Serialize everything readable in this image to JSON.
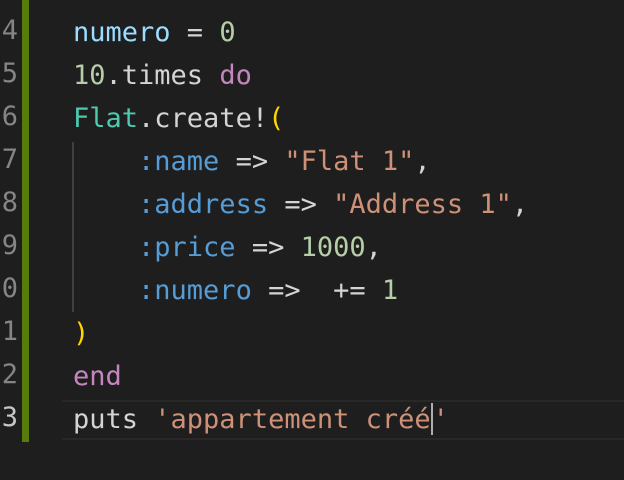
{
  "editor": {
    "line_numbers": [
      "4",
      "5",
      "6",
      "7",
      "8",
      "9",
      "0",
      "1",
      "2",
      "3"
    ],
    "lines": [
      [
        {
          "t": "numero",
          "c": "var"
        },
        {
          "t": " = ",
          "c": "op"
        },
        {
          "t": "0",
          "c": "num"
        }
      ],
      [
        {
          "t": "10",
          "c": "num"
        },
        {
          "t": ".times ",
          "c": "plain"
        },
        {
          "t": "do",
          "c": "kw"
        }
      ],
      [
        {
          "t": "Flat",
          "c": "class"
        },
        {
          "t": ".create!",
          "c": "plain"
        },
        {
          "t": "(",
          "c": "paren"
        }
      ],
      [
        {
          "t": "    ",
          "c": "plain"
        },
        {
          "t": ":name",
          "c": "sym"
        },
        {
          "t": " => ",
          "c": "op"
        },
        {
          "t": "\"Flat 1\"",
          "c": "str"
        },
        {
          "t": ",",
          "c": "plain"
        }
      ],
      [
        {
          "t": "    ",
          "c": "plain"
        },
        {
          "t": ":address",
          "c": "sym"
        },
        {
          "t": " => ",
          "c": "op"
        },
        {
          "t": "\"Address 1\"",
          "c": "str"
        },
        {
          "t": ",",
          "c": "plain"
        }
      ],
      [
        {
          "t": "    ",
          "c": "plain"
        },
        {
          "t": ":price",
          "c": "sym"
        },
        {
          "t": " => ",
          "c": "op"
        },
        {
          "t": "1000",
          "c": "num"
        },
        {
          "t": ",",
          "c": "plain"
        }
      ],
      [
        {
          "t": "    ",
          "c": "plain"
        },
        {
          "t": ":numero",
          "c": "sym"
        },
        {
          "t": " =>  += ",
          "c": "op"
        },
        {
          "t": "1",
          "c": "num"
        }
      ],
      [
        {
          "t": ")",
          "c": "paren"
        }
      ],
      [
        {
          "t": "end",
          "c": "kw"
        }
      ],
      [
        {
          "t": "puts ",
          "c": "plain"
        },
        {
          "t": "'appartement créé",
          "c": "str"
        },
        {
          "t": "|",
          "c": "cursor"
        },
        {
          "t": "'",
          "c": "str"
        }
      ]
    ],
    "active_line": 9,
    "colors": {
      "background": "#1e1e1e",
      "git_modified": "#587c0c",
      "variable": "#9cdcfe",
      "number": "#b5cea8",
      "keyword": "#c586c0",
      "class": "#4ec9b0",
      "symbol": "#569cd6",
      "string": "#ce9178",
      "bracket": "#ffd700"
    }
  }
}
